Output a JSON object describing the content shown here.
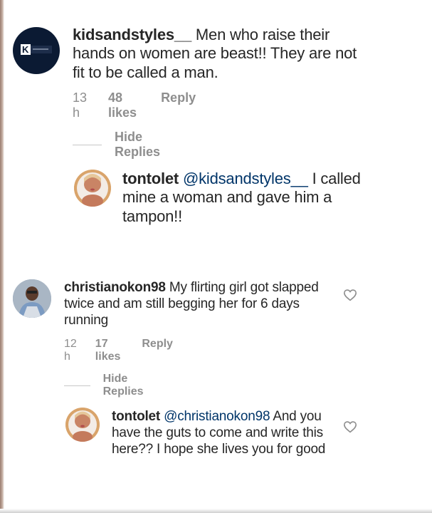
{
  "comments": [
    {
      "username": "kidsandstyles__",
      "text": "Men who raise their hands on women are beast!! They are not fit to be called a man.",
      "time": "13 h",
      "likes": "48 likes",
      "reply": "Reply",
      "avatar_letter": "K",
      "hide_replies": "Hide Replies",
      "replies": [
        {
          "username": "tontolet",
          "mention": "@kidsandstyles__",
          "text": "I called mine a woman and gave him a tampon!!"
        }
      ]
    },
    {
      "username": "christianokon98",
      "text": "My flirting girl got slapped twice and am still begging her for 6 days running",
      "time": "12 h",
      "likes": "17 likes",
      "reply": "Reply",
      "hide_replies": "Hide Replies",
      "replies": [
        {
          "username": "tontolet",
          "mention": "@christianokon98",
          "text": "And you have the guts to come and write this here?? I hope she lives you for good"
        }
      ]
    }
  ],
  "icons": {
    "heart": "heart-outline-icon",
    "avatar_brand": "kidsandstyles-logo"
  },
  "colors": {
    "username": "#262626",
    "mention": "#003569",
    "meta": "#8e8e8e",
    "avatar_dark": "#0b1a33"
  }
}
